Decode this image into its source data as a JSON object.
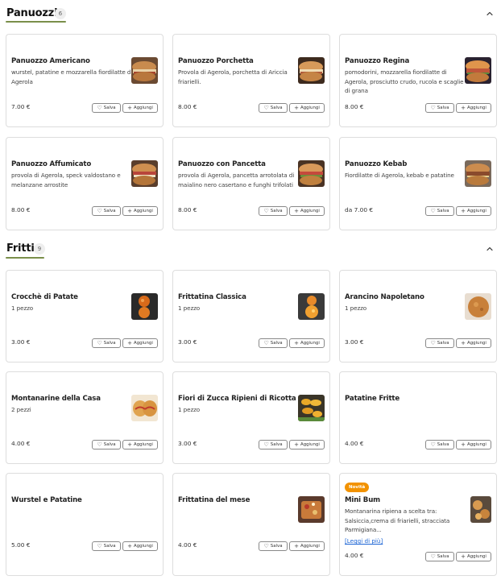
{
  "sections": [
    {
      "title": "Panuozzi",
      "count": "6"
    },
    {
      "title": "Fritti",
      "count": "9"
    }
  ],
  "buttons": {
    "save": "Salva",
    "add": "Aggiungi"
  },
  "panuozzi": [
    {
      "name": "Panuozzo Americano",
      "desc": "wurstel, patatine e mozzarella fiordilatte di Agerola",
      "price": "7.00 €",
      "thumb": "sandwich"
    },
    {
      "name": "Panuozzo Porchetta",
      "desc": "Provola di Agerola, porchetta di Ariccia friarielli.",
      "price": "8.00 €",
      "thumb": "sandwich"
    },
    {
      "name": "Panuozzo Regina",
      "desc": "pomodorini, mozzarella fiordilatte di Agerola, prosciutto crudo, rucola e scaglie di grana",
      "price": "8.00 €",
      "thumb": "sandwich-dark"
    },
    {
      "name": "Panuozzo Affumicato",
      "desc": "provola di Agerola, speck valdostano e melanzane arrostite",
      "price": "8.00 €",
      "thumb": "sandwich"
    },
    {
      "name": "Panuozzo con Pancetta",
      "desc": "provola di Agerola, pancetta arrotolata di maialino nero casertano e funghi trifolati",
      "price": "8.00 €",
      "thumb": "sandwich"
    },
    {
      "name": "Panuozzo Kebab",
      "desc": "Fiordilatte di Agerola, kebab e patatine",
      "price": "da 7.00 €",
      "thumb": "sandwich"
    }
  ],
  "fritti": [
    {
      "name": "Crocchè di Patate",
      "desc": "1 pezzo",
      "price": "3.00 €",
      "thumb": "fried-balls"
    },
    {
      "name": "Frittatina Classica",
      "desc": "1 pezzo",
      "price": "3.00 €",
      "thumb": "fried-balls"
    },
    {
      "name": "Arancino Napoletano",
      "desc": "1 pezzo",
      "price": "3.00 €",
      "thumb": "arancino"
    },
    {
      "name": "Montanarine della Casa",
      "desc": "2 pezzi",
      "price": "4.00 €",
      "thumb": "montanarine"
    },
    {
      "name": "Fiori di Zucca Ripieni di Ricotta",
      "desc": "1 pezzo",
      "price": "3.00 €",
      "thumb": "flowers"
    },
    {
      "name": "Patatine Fritte",
      "desc": "",
      "price": "4.00 €",
      "thumb": ""
    },
    {
      "name": "Wurstel e Patatine",
      "desc": "",
      "price": "5.00 €",
      "thumb": ""
    },
    {
      "name": "Frittatina del mese",
      "desc": "",
      "price": "4.00 €",
      "thumb": "frittatina"
    },
    {
      "name": "Mini Bum",
      "badge": "Novità",
      "desc": "Montanarina ripiena a scelta tra: Salsiccia,crema di friarielli, stracciata Parmigiana...",
      "read_more": "[Leggi di più]",
      "price": "4.00 €",
      "thumb": "minibum"
    }
  ],
  "colors": {
    "accent": "#7a8f4a",
    "badge": "#f29200",
    "link": "#1a63d4"
  },
  "icons": {
    "collapse": "chevron-up-icon",
    "save": "heart-icon",
    "add": "plus-icon"
  }
}
